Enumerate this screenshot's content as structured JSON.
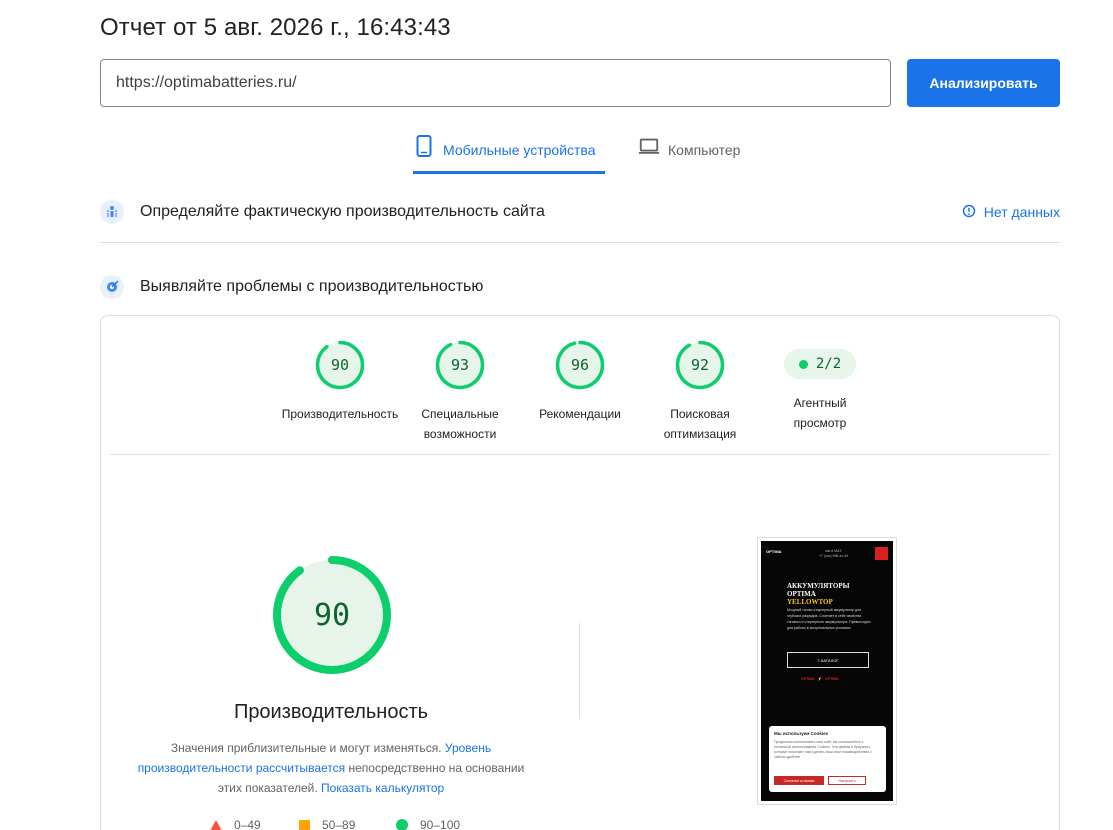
{
  "header": {
    "report_title": "Отчет от 5 авг. 2026 г., 16:43:43",
    "url_value": "https://optimabatteries.ru/",
    "analyze_label": "Анализировать"
  },
  "tabs": [
    {
      "label": "Мобильные устройства",
      "icon": "smartphone-icon",
      "active": true
    },
    {
      "label": "Компьютер",
      "icon": "laptop-icon",
      "active": false
    }
  ],
  "sections": {
    "field_data": {
      "title": "Определяйте фактическую производительность сайта",
      "icon": "users-icon",
      "status": "Нет данных",
      "status_icon": "info-icon"
    },
    "lab_data": {
      "title": "Выявляйте проблемы с производительностью",
      "icon": "lighthouse-icon"
    }
  },
  "scores": [
    {
      "value": 90,
      "display": "90",
      "label_line1": "Производительность",
      "label_line2": ""
    },
    {
      "value": 93,
      "display": "93",
      "label_line1": "Специальные",
      "label_line2": "возможности"
    },
    {
      "value": 96,
      "display": "96",
      "label_line1": "Рекомендации",
      "label_line2": ""
    },
    {
      "value": 92,
      "display": "92",
      "label_line1": "Поисковая",
      "label_line2": "оптимизация"
    }
  ],
  "agent": {
    "value": "2/2",
    "label_line1": "Агентный",
    "label_line2": "просмотр"
  },
  "performance": {
    "score": 90,
    "display": "90",
    "title": "Производительность",
    "desc_prefix": "Значения приблизительные и могут изменяться.",
    "desc_link1": "Уровень производительности рассчитывается",
    "desc_middle": "непосредственно на основании этих показателей.",
    "desc_link2": "Показать калькулятор"
  },
  "legend": [
    {
      "range": "0–49",
      "shape": "triangle",
      "color": "#ff4e42"
    },
    {
      "range": "50–89",
      "shape": "square",
      "color": "#ffa400"
    },
    {
      "range": "90–100",
      "shape": "circle",
      "color": "#0cce6b"
    }
  ],
  "colors": {
    "accent": "#1a73e8",
    "pass": "#0cce6b",
    "pass_fill": "#e6f4ea",
    "pass_text": "#0d652d"
  },
  "screenshot": {
    "logo": "OPTIMA",
    "phone_line1": "мы в MAX",
    "phone_line2": "+7 (xxx) 998-xx-44",
    "headline1": "АККУМУЛЯТОРЫ",
    "headline2": "OPTIMA",
    "headline3": "YELLOWTOP",
    "text": "Мощный тягово-стартерный аккумулятор для глубоких разрядов. Сочетает в себе свойства тягового и стартерного аккумулятора. Превосходно для работы в экстремальных условиях",
    "catalog_label": "≡ КАТАЛОГ",
    "brands": "OPTIMA · ⚡ · OPTIMA",
    "cookie_title": "Мы используем Cookies",
    "cookie_text": "Продолжая использовать наш сайт, вы соглашаетесь с политикой использования Cookies. Эти файлы и браузеры, которые помогают нам сделать ваш опыт взаимодействия с сайтом удобнее",
    "cookie_accept": "Согласен со всеми",
    "cookie_configure": "Настроить"
  }
}
